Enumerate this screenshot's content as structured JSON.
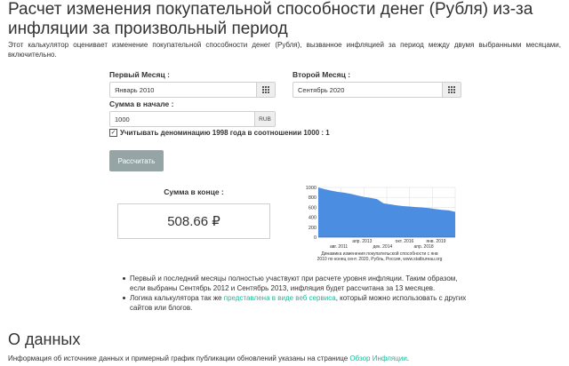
{
  "header": {
    "title": "Расчет изменения покупательной способности денег (Рубля) из-за инфляции за произвольный период",
    "intro": "Этот калькулятор оценивает изменение покупательной способности денег (Рубля), вызванное инфляцией за период между двумя выбранными месяцами, включительно."
  },
  "form": {
    "first_month_label": "Первый Месяц :",
    "first_month_value": "Январь 2010",
    "second_month_label": "Второй Месяц :",
    "second_month_value": "Сентябрь 2020",
    "amount_label": "Сумма в начале :",
    "amount_value": "1000",
    "currency": "RUB",
    "calendar_icon": "calendar-icon",
    "checkbox_checked": true,
    "checkbox_mark": "✓",
    "checkbox_label": "Учитывать деноминацию 1998 года в соотношении 1000 : 1",
    "calculate_label": "Рассчитать",
    "button_color": "#95a5a6"
  },
  "result": {
    "label": "Сумма в конце :",
    "value": "508.66 ₽"
  },
  "chart_data": {
    "type": "area",
    "x": [
      "2010-01",
      "2010-07",
      "2011-01",
      "2011-07",
      "2012-01",
      "2012-07",
      "2013-01",
      "2013-07",
      "2014-01",
      "2014-07",
      "2015-01",
      "2015-07",
      "2016-01",
      "2016-07",
      "2017-01",
      "2017-07",
      "2018-01",
      "2018-07",
      "2019-01",
      "2019-07",
      "2020-01",
      "2020-09"
    ],
    "values": [
      1000,
      965,
      935,
      910,
      895,
      870,
      840,
      810,
      790,
      765,
      680,
      660,
      640,
      625,
      615,
      605,
      595,
      585,
      565,
      550,
      540,
      509
    ],
    "ylim": [
      0,
      1000
    ],
    "y_ticks": [
      "1000",
      "800",
      "600",
      "400",
      "200",
      "0"
    ],
    "x_ticks_top": [
      "апр. 2013",
      "окт. 2016",
      "янв. 2019"
    ],
    "x_ticks_bottom": [
      "авг. 2011",
      "дек. 2014",
      "апр. 2018"
    ],
    "fill_color": "#4b8de0",
    "grid": true,
    "caption_line1": "Динамика изменения покупательской способности с янв",
    "caption_line2": "2010 по конец сент. 2020, Рубль, Россия, www.statbureau.org"
  },
  "notes": {
    "item1": "Первый и последний месяцы полностью участвуют при расчете уровня инфляции. Таким образом, если выбраны Сентябрь 2012 и Сентябрь 2013, инфляция будет рассчитана за 13 месяцев.",
    "item2_before": "Логика калькулятора так же ",
    "item2_link": "представлена в виде веб сервиса",
    "item2_after": ", который можно использовать с других сайтов или блогов."
  },
  "about": {
    "title": "О данных",
    "text_before": "Информация об источнике данных и примерный график публикации обновлений указаны на странице ",
    "link": "Обзор Инфляции",
    "text_after": ".",
    "link_color": "#18bc9c"
  }
}
